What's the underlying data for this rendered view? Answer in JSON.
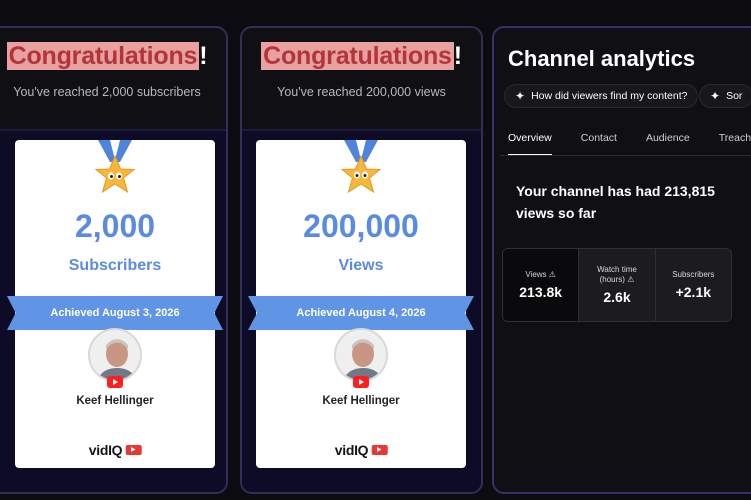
{
  "panels": [
    {
      "congrats_word": "Congratulations",
      "congrats_bang": "!",
      "subtitle": "You've reached 2,000 subscribers",
      "big_number": "2,000",
      "metric_label": "Subscribers",
      "achieved": "Achieved August 3, 2026",
      "name": "Keef Hellinger",
      "brand": "vidIQ",
      "brand_badge": "YouTube"
    },
    {
      "congrats_word": "Congratulations",
      "congrats_bang": "!",
      "subtitle": "You've reached 200,000 views",
      "big_number": "200,000",
      "metric_label": "Views",
      "achieved": "Achieved August 4, 2026",
      "name": "Keef Hellinger",
      "brand": "vidIQ",
      "brand_badge": "YouTube"
    }
  ],
  "analytics": {
    "title": "Channel analytics",
    "chips": [
      "How did viewers find my content?",
      "Sor"
    ],
    "tabs": [
      "Overview",
      "Contact",
      "Audience",
      "Treach"
    ],
    "summary": "Your channel has had 213,815 views so far",
    "stats": [
      {
        "label": "Views",
        "value": "213.8k"
      },
      {
        "label": "Watch time (hours)",
        "value": "2.6k"
      },
      {
        "label": "Subscribers",
        "value": "+2.1k"
      }
    ]
  },
  "colors": {
    "accent_blue": "#5b8be0",
    "highlight_bg": "#e8a0a0",
    "highlight_text": "#b2353b",
    "panel_border": "#2f2f58"
  },
  "icons": [
    "medal-icon",
    "youtube-icon",
    "sparkle-icon",
    "warning-icon"
  ]
}
